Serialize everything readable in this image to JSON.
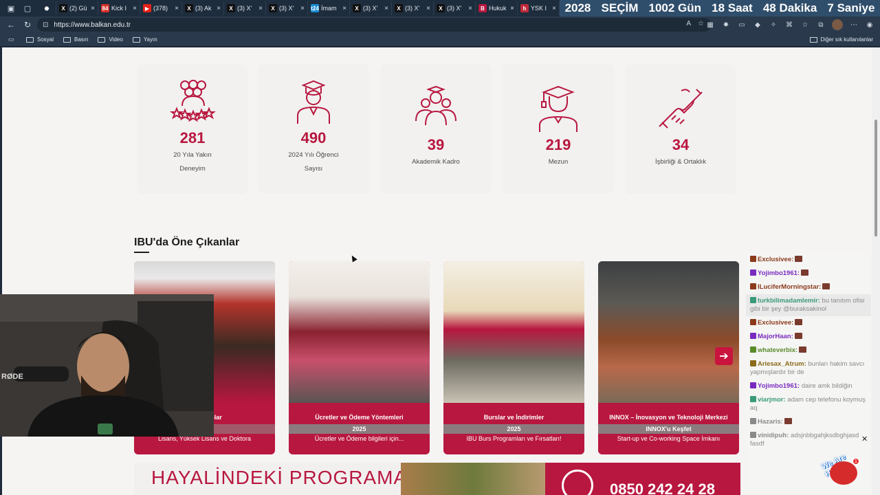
{
  "tabbar": {
    "tabs": [
      {
        "label": "",
        "fav_color": "#1e2d3d",
        "glyph": "⬣"
      },
      {
        "label": "(2) Gü",
        "fav_color": "#111111",
        "glyph": "X"
      },
      {
        "label": "Kick I",
        "fav_color": "#d8312b",
        "glyph": "84"
      },
      {
        "label": "(378)",
        "fav_color": "#e62117",
        "glyph": "▶"
      },
      {
        "label": "(3) Ak",
        "fav_color": "#111111",
        "glyph": "X"
      },
      {
        "label": "(3) X'",
        "fav_color": "#111111",
        "glyph": "X"
      },
      {
        "label": "(3) X'",
        "fav_color": "#111111",
        "glyph": "X"
      },
      {
        "label": "İmam",
        "fav_color": "#1d8ed6",
        "glyph": "t24"
      },
      {
        "label": "(3) X'",
        "fav_color": "#111111",
        "glyph": "X"
      },
      {
        "label": "(3) X'",
        "fav_color": "#111111",
        "glyph": "X"
      },
      {
        "label": "(3) X'",
        "fav_color": "#111111",
        "glyph": "X"
      },
      {
        "label": "Hukuk",
        "fav_color": "#b8173f",
        "glyph": "B"
      },
      {
        "label": "YSK I",
        "fav_color": "#c02a3a",
        "glyph": "h"
      }
    ],
    "countdown": [
      "2028",
      "SEÇİM",
      "1002 Gün",
      "18 Saat",
      "48 Dakika",
      "7 Saniye"
    ]
  },
  "address": {
    "url": "https://www.balkan.edu.tr"
  },
  "bookmarks": {
    "items": [
      "Sosyal",
      "Basın",
      "Video",
      "Yayın"
    ],
    "other": "Diğer sık kullanılanlar"
  },
  "stats": [
    {
      "value": "281",
      "label_lines": [
        "20 Yıla Yakın",
        "Deneyim"
      ],
      "icon": "group-stars-icon"
    },
    {
      "value": "490",
      "label_lines": [
        "2024 Yılı Öğrenci",
        "Sayısı"
      ],
      "icon": "student-icon"
    },
    {
      "value": "39",
      "label_lines": [
        "Akademik Kadro"
      ],
      "icon": "academic-staff-icon"
    },
    {
      "value": "219",
      "label_lines": [
        "Mezun"
      ],
      "icon": "graduate-icon"
    },
    {
      "value": "34",
      "label_lines": [
        "İşbirliği & Ortaklık"
      ],
      "icon": "handshake-icon"
    }
  ],
  "highlights": {
    "title": "IBU'da Öne Çıkanlar",
    "cards": [
      {
        "title": "...ntenjanlar",
        "year": "",
        "desc": "Lisans, Yüksek Lisans ve Doktora"
      },
      {
        "title": "Ücretler ve Ödeme Yöntemleri",
        "year": "2025",
        "desc": "Ücretler ve Ödeme bilgileri için..."
      },
      {
        "title": "Burslar ve İndirimler",
        "year": "2025",
        "desc": "IBU Burs Programları ve Fırsatları!"
      },
      {
        "title": "INNOX – İnovasyon ve Teknoloji Merkezi",
        "year": "INNOX'u Keşfet",
        "desc": "Start-up ve Co-working Space İmkanı"
      }
    ]
  },
  "banner": {
    "text": "HAYALİNDEKİ PROGRAMA",
    "phone": "0850 242 24 28"
  },
  "chat": {
    "messages": [
      {
        "user": "Exclusivee:",
        "color": "#8b3a1a",
        "text": "",
        "emote": true,
        "highlight": false
      },
      {
        "user": "Yojimbo1961:",
        "color": "#7a2bbf",
        "text": "",
        "emote": true,
        "highlight": false
      },
      {
        "user": "ILuciferMorningstar:",
        "color": "#8b3a1a",
        "text": "",
        "emote": true,
        "highlight": false
      },
      {
        "user": "turkbilimadamlemir:",
        "color": "#3a9a7a",
        "text": " bu tanıtım ofisi gibi bir şey @buraksakinol",
        "emote": false,
        "highlight": true
      },
      {
        "user": "Exclusivee:",
        "color": "#8b3a1a",
        "text": "",
        "emote": true,
        "highlight": false
      },
      {
        "user": "MajorHaan:",
        "color": "#7a2bbf",
        "text": "",
        "emote": true,
        "highlight": false
      },
      {
        "user": "whateverbix:",
        "color": "#5a8a2a",
        "text": "",
        "emote": true,
        "highlight": false
      },
      {
        "user": "Ariesax_Atrum:",
        "color": "#8b6a1a",
        "text": " bunları hakim savcı yapmışlardır bir de",
        "emote": false,
        "highlight": false
      },
      {
        "user": "Yojimbo1961:",
        "color": "#7a2bbf",
        "text": " daire amk bildiğin",
        "emote": false,
        "highlight": false
      },
      {
        "user": "viarjmor:",
        "color": "#3a9a7a",
        "text": " adam cep telefonu koymuş aq",
        "emote": false,
        "highlight": false
      },
      {
        "user": "Hazaris:",
        "color": "#8a8a8a",
        "text": "",
        "emote": true,
        "highlight": false
      },
      {
        "user": "vinidipuh:",
        "color": "#8a8a8a",
        "text": " adsjnbbgahjksdbghjasd fasdf",
        "emote": false,
        "highlight": false
      }
    ],
    "overlay_text": "We Are Here!",
    "notif_count": "1"
  },
  "brand_colors": {
    "accent": "#b8173f"
  }
}
